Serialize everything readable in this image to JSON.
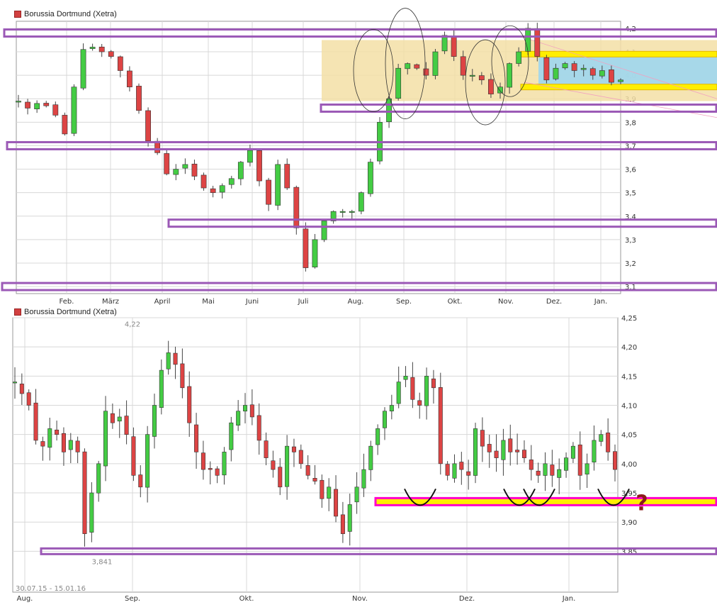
{
  "colors": {
    "up": "#44cc44",
    "down": "#dd4444",
    "band": "#9b59b6",
    "range_fill": "#f3dfa6",
    "support_yellow": "#ffee00",
    "support_magenta": "#ff00cc",
    "channel_blue": "#9fd6ee",
    "grid": "#d8d8d8"
  },
  "chart_data": [
    {
      "type": "candlestick",
      "legend_label": "Borussia Dortmund (Xetra)",
      "x_axis_months": [
        "Feb.",
        "März",
        "April",
        "Mai",
        "Juni",
        "Juli",
        "Aug.",
        "Sep.",
        "Okt.",
        "Nov.",
        "Dez.",
        "Jan."
      ],
      "y_ticks": [
        "4,2",
        "4,1",
        "4,0",
        "3,9",
        "3,8",
        "3,7",
        "3,6",
        "3,5",
        "3,4",
        "3,3",
        "3,2",
        "3,1"
      ],
      "ylim": [
        3.07,
        4.23
      ],
      "grid": true,
      "approx_close_path": [
        3.89,
        3.86,
        3.88,
        3.87,
        3.83,
        3.75,
        3.95,
        4.11,
        4.12,
        4.1,
        4.08,
        4.02,
        3.95,
        3.85,
        3.72,
        3.67,
        3.58,
        3.6,
        3.62,
        3.57,
        3.52,
        3.5,
        3.53,
        3.56,
        3.63,
        3.68,
        3.55,
        3.45,
        3.62,
        3.52,
        3.35,
        3.18,
        3.3,
        3.38,
        3.42,
        3.42,
        3.42,
        3.5,
        3.63,
        3.8,
        3.9,
        4.03,
        4.05,
        4.03,
        4.0,
        4.1,
        4.17,
        4.08,
        4.0,
        4.0,
        3.98,
        3.92,
        3.95,
        4.05,
        4.1,
        4.2,
        4.08,
        3.98,
        4.03,
        4.05,
        4.02,
        4.03,
        4.0,
        4.02,
        3.97,
        3.98
      ],
      "annotations": [
        {
          "kind": "horizontal_band",
          "level": 4.18,
          "color": "band"
        },
        {
          "kind": "horizontal_band",
          "level": 3.86,
          "color": "band"
        },
        {
          "kind": "horizontal_band",
          "level": 3.7,
          "color": "band"
        },
        {
          "kind": "horizontal_band",
          "level": 3.37,
          "color": "band"
        },
        {
          "kind": "horizontal_band",
          "level": 3.1,
          "color": "band"
        },
        {
          "kind": "range_box",
          "from_month": "Aug.",
          "y_range": [
            3.89,
            4.15
          ],
          "color": "range_fill"
        },
        {
          "kind": "yellow_band",
          "level": 4.09
        },
        {
          "kind": "yellow_band",
          "level": 3.95
        },
        {
          "kind": "blue_channel",
          "y_range": [
            3.95,
            4.08
          ]
        }
      ]
    },
    {
      "type": "candlestick",
      "legend_label": "Borussia Dortmund (Xetra)",
      "date_range": "30.07.15 - 15.01.16",
      "x_axis_months": [
        "Aug.",
        "Sep.",
        "Okt.",
        "Nov.",
        "Dez.",
        "Jan."
      ],
      "y_ticks": [
        "4,25",
        "4,20",
        "4,15",
        "4,10",
        "4,05",
        "4,00",
        "3,95",
        "3,90",
        "3,85"
      ],
      "ylim": [
        3.78,
        4.25
      ],
      "grid": true,
      "high_label": "4,22",
      "low_label": "3,841",
      "approx_close_path": [
        4.14,
        4.12,
        4.1,
        4.04,
        4.03,
        4.06,
        4.05,
        4.02,
        4.04,
        4.02,
        3.88,
        3.95,
        4.0,
        4.09,
        4.07,
        4.08,
        4.05,
        3.98,
        3.96,
        4.05,
        4.1,
        4.16,
        4.19,
        4.17,
        4.13,
        4.07,
        4.02,
        3.99,
        3.99,
        3.98,
        4.02,
        4.07,
        4.09,
        4.1,
        4.08,
        4.04,
        4.01,
        3.99,
        3.96,
        4.03,
        4.02,
        4.0,
        3.98,
        3.97,
        3.94,
        3.96,
        3.91,
        3.88,
        3.93,
        3.96,
        3.99,
        4.03,
        4.06,
        4.09,
        4.1,
        4.14,
        4.15,
        4.11,
        4.1,
        4.15,
        4.13,
        4.0,
        3.98,
        4.0,
        3.99,
        3.98,
        4.06,
        4.03,
        4.02,
        4.01,
        4.04,
        4.02,
        4.02,
        4.01,
        3.99,
        3.98,
        4.0,
        3.98,
        3.99,
        4.01,
        4.03,
        3.98,
        4.0,
        4.04,
        4.05,
        4.02,
        3.99
      ],
      "annotations": [
        {
          "kind": "horizontal_band",
          "level": 3.85,
          "color": "band"
        },
        {
          "kind": "horizontal_band",
          "level": 3.935,
          "color": "support_magenta"
        },
        {
          "kind": "question_mark",
          "text": "?"
        }
      ]
    }
  ]
}
